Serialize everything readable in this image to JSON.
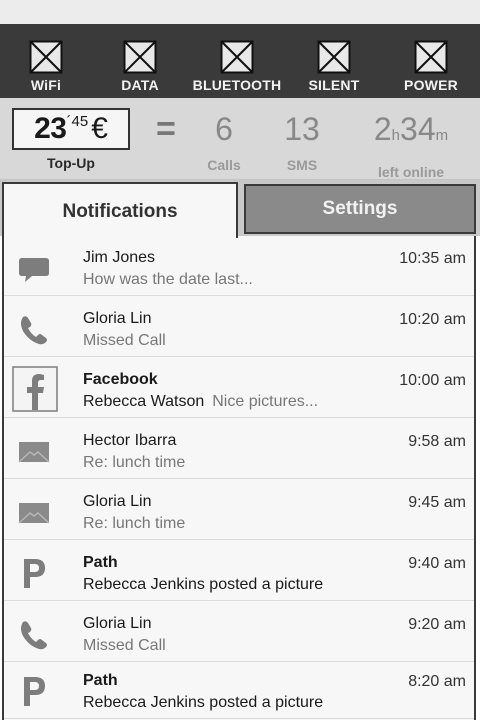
{
  "toggles": [
    {
      "label": "WiFi",
      "icon": "wifi-toggle-icon"
    },
    {
      "label": "DATA",
      "icon": "data-toggle-icon"
    },
    {
      "label": "BLUETOOTH",
      "icon": "bluetooth-toggle-icon"
    },
    {
      "label": "SILENT",
      "icon": "silent-toggle-icon"
    },
    {
      "label": "POWER",
      "icon": "power-toggle-icon"
    }
  ],
  "status": {
    "credit_whole": "23",
    "credit_cents": "´45",
    "currency": "€",
    "credit_label": "Top-Up",
    "equals": "=",
    "calls_value": "6",
    "calls_label": "Calls",
    "sms_value": "13",
    "sms_label": "SMS",
    "hours": "2",
    "hours_unit": "h",
    "minutes": "34",
    "minutes_unit": "m",
    "online_label": "left online"
  },
  "tabs": {
    "notifications": "Notifications",
    "settings": "Settings"
  },
  "notifications": [
    {
      "icon": "chat-bubble-icon",
      "title": "Jim Jones",
      "bold": false,
      "sender": "",
      "message": "How was the date last...",
      "time": "10:35 am"
    },
    {
      "icon": "phone-icon",
      "title": "Gloria Lin",
      "bold": false,
      "sender": "",
      "message": "Missed Call",
      "time": "10:20 am"
    },
    {
      "icon": "facebook-icon",
      "title": "Facebook",
      "bold": true,
      "sender": "Rebecca Watson",
      "message": "Nice pictures...",
      "time": "10:00 am"
    },
    {
      "icon": "envelope-icon",
      "title": "Hector Ibarra",
      "bold": false,
      "sender": "",
      "message": "Re: lunch time",
      "time": "9:58 am"
    },
    {
      "icon": "envelope-icon",
      "title": "Gloria Lin",
      "bold": false,
      "sender": "",
      "message": "Re: lunch time",
      "time": "9:45 am"
    },
    {
      "icon": "path-icon",
      "title": "Path",
      "bold": true,
      "sender": "Rebecca Jenkins posted a picture",
      "message": "",
      "time": "9:40 am"
    },
    {
      "icon": "phone-icon",
      "title": "Gloria Lin",
      "bold": false,
      "sender": "",
      "message": "Missed Call",
      "time": "9:20 am"
    },
    {
      "icon": "path-icon",
      "title": "Path",
      "bold": true,
      "sender": "Rebecca Jenkins posted a picture",
      "message": "",
      "time": "8:20 am"
    }
  ]
}
